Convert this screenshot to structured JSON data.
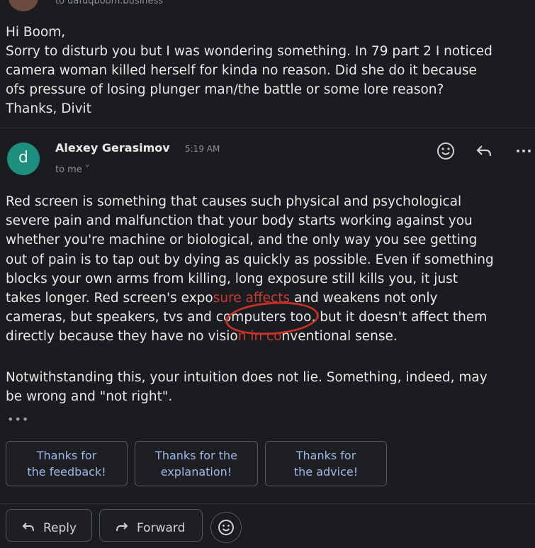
{
  "header": {
    "to_line": "to dafuqboom.business ˅"
  },
  "previous_message": {
    "lines": [
      "Hi Boom,",
      "Sorry to disturb you but I was wondering something. In 79 part 2 I noticed",
      "camera woman killed herself for kinda no reason. Did she do it because",
      "ofs pressure of losing plunger man/the battle or some lore reason?",
      "Thanks, Divit"
    ]
  },
  "reply_message": {
    "avatar_letter": "d",
    "avatar_color": "#1e8e7e",
    "sender": "Alexey Gerasimov",
    "time": "5:19 AM",
    "to": "to me ˅",
    "actions": {
      "emoji_icon": "smiley-icon",
      "reply_icon": "reply-arrow-icon",
      "more_icon": "more-horizontal-icon"
    },
    "body_lines": [
      "Red screen is something that causes such physical and psychological",
      "severe pain and malfunction that your body starts working against you",
      "whether you're machine or biological, and the only way you see getting",
      "out of pain is to tap out by dying as quickly as possible. Even if something",
      "blocks your own arms from killing, long exposure still kills you, it just"
    ],
    "line6": {
      "a": "takes longer. Red screen's expo",
      "b": "sure affects",
      "c": " and weakens not only"
    },
    "line7": "cameras, but speakers, tvs and computers too, but it doesn't affect them",
    "line8": {
      "a": "directly because they have no visio",
      "b": "n in co",
      "c": "nventional sense."
    },
    "para2_lines": [
      "Notwithstanding this, your intuition does not lie. Something, indeed, may",
      "be wrong and \"not right\"."
    ],
    "ellipsis": "•••"
  },
  "smart_replies": [
    {
      "line1": "Thanks for",
      "line2": "the feedback!"
    },
    {
      "line1": "Thanks for the",
      "line2": "explanation!"
    },
    {
      "line1": "Thanks for",
      "line2": "the advice!"
    }
  ],
  "footer": {
    "reply_label": "Reply",
    "forward_label": "Forward",
    "emoji_icon": "smiley-icon"
  },
  "colors": {
    "background": "#1b1c1f",
    "chip_text": "#9fb7e9",
    "annotation_red": "#c4302b"
  }
}
